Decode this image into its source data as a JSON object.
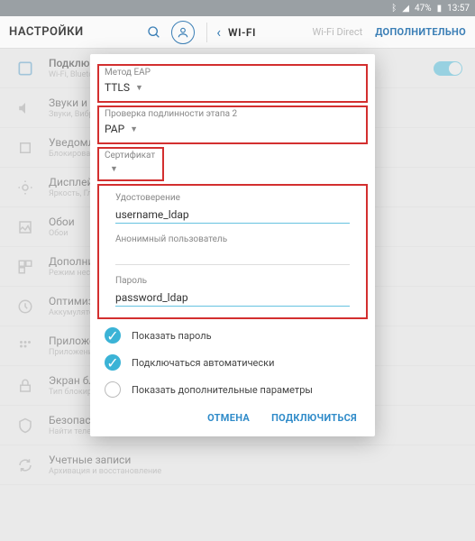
{
  "status": {
    "battery": "47%",
    "time": "13:57"
  },
  "appbar": {
    "title": "НАСТРОЙКИ",
    "section": "WI-FI",
    "wifi_direct": "Wi-Fi Direct",
    "more": "ДОПОЛНИТЕЛЬНО"
  },
  "list": {
    "items": [
      {
        "label": "Подключения",
        "sub": "Wi-Fi, Bluetooth"
      },
      {
        "label": "Звуки и вибрация",
        "sub": "Звуки, Вибрация"
      },
      {
        "label": "Уведомления",
        "sub": "Блокирование"
      },
      {
        "label": "Дисплей",
        "sub": "Яркость, Главный экран"
      },
      {
        "label": "Обои",
        "sub": "Обои"
      },
      {
        "label": "Дополнительные функции",
        "sub": "Режим нескольких окон"
      },
      {
        "label": "Оптимизация",
        "sub": "Аккумулятор"
      },
      {
        "label": "Приложения",
        "sub": "Приложения"
      },
      {
        "label": "Экран блокировки",
        "sub": "Тип блокировки"
      },
      {
        "label": "Безопасность",
        "sub": "Найти телефон"
      },
      {
        "label": "Учетные записи",
        "sub": "Архивация и восстановление"
      }
    ]
  },
  "dialog": {
    "eap": {
      "label": "Метод EAP",
      "value": "TTLS"
    },
    "phase2": {
      "label": "Проверка подлинности этапа 2",
      "value": "PAP"
    },
    "cert": {
      "label": "Сертификат",
      "value": ""
    },
    "identity": {
      "label": "Удостоверение",
      "value": "username_ldap"
    },
    "anon": {
      "label": "Анонимный пользователь",
      "value": ""
    },
    "password": {
      "label": "Пароль",
      "value": "password_ldap"
    },
    "show_password": "Показать пароль",
    "auto_connect": "Подключаться автоматически",
    "show_advanced": "Показать дополнительные параметры",
    "cancel": "ОТМЕНА",
    "connect": "ПОДКЛЮЧИТЬСЯ"
  }
}
